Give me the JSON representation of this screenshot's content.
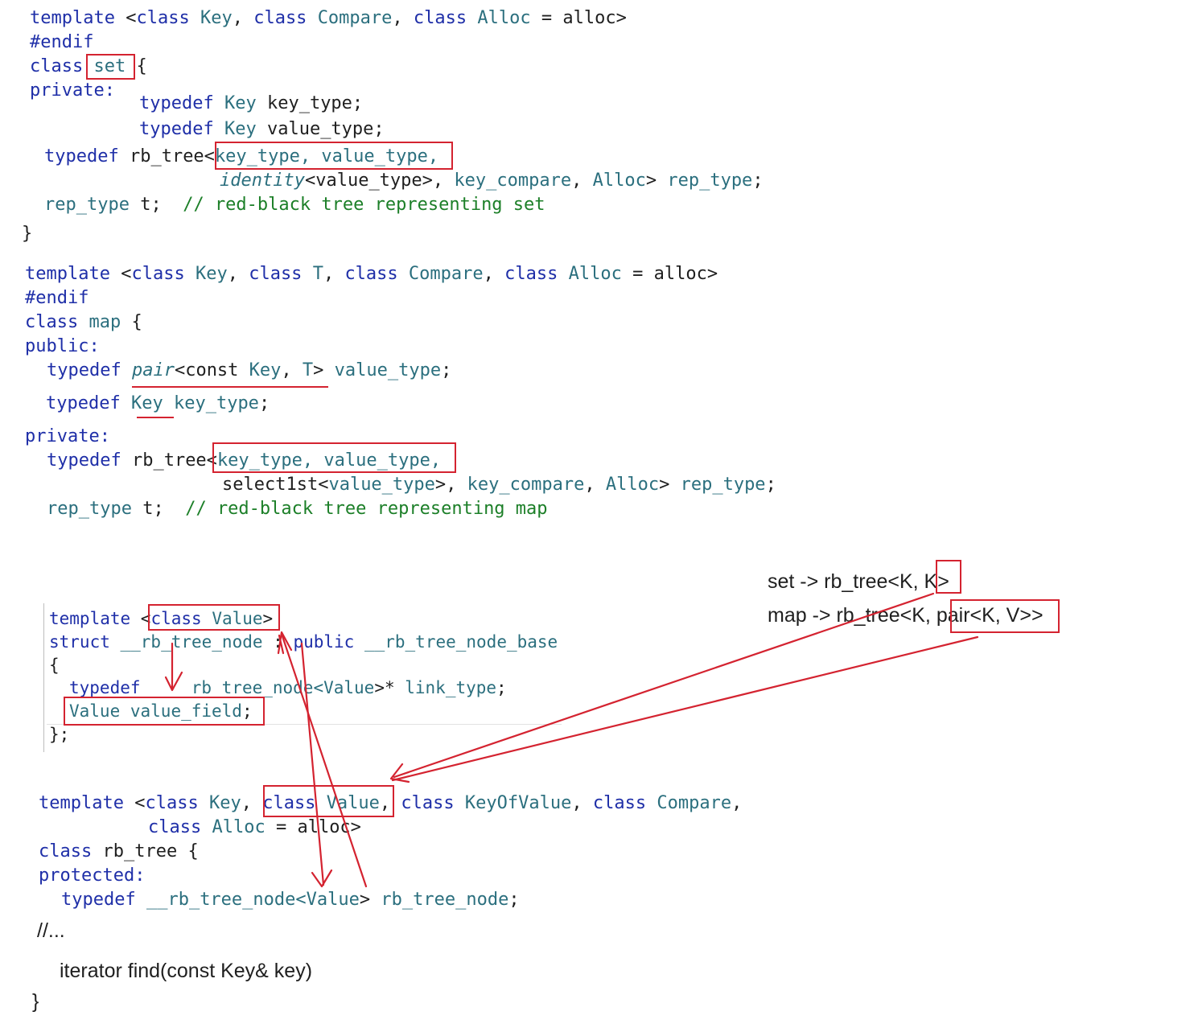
{
  "set_block": {
    "line1": [
      "template ",
      "<",
      "class",
      " ",
      "Key",
      ", ",
      "class",
      " ",
      "Compare",
      ", ",
      "class",
      " ",
      "Alloc",
      " = alloc>"
    ],
    "line2": "#endif",
    "line3_kw": "class",
    "line3_name": " set ",
    "line3_rest": "{",
    "line4": "private:",
    "line5": [
      "typedef",
      " ",
      "Key",
      " key_type;"
    ],
    "line6": [
      "typedef",
      " ",
      "Key",
      " value_type;"
    ],
    "line7": [
      "typedef",
      " rb_tree<",
      "key_type, value_type,"
    ],
    "line8": [
      "identity",
      "<value_type>, ",
      "key_compare",
      ", ",
      "Alloc",
      "> ",
      "rep_type",
      ";"
    ],
    "line9": [
      "rep_type",
      " t;  ",
      "// red-black tree representing set"
    ],
    "line10": "}"
  },
  "map_block": {
    "line1": [
      "template ",
      "<",
      "class",
      " ",
      "Key",
      ", ",
      "class",
      " ",
      "T",
      ", ",
      "class",
      " ",
      "Compare",
      ", ",
      "class",
      " ",
      "Alloc",
      " = alloc>"
    ],
    "line2": "#endif",
    "line3": [
      "class",
      " ",
      "map",
      " {"
    ],
    "line4": "public:",
    "line5": [
      "typedef",
      " ",
      "pair",
      "<const ",
      "Key",
      ", ",
      "T",
      "> ",
      "value_type",
      ";"
    ],
    "line6": [
      "typedef",
      " ",
      "Key",
      " ",
      "key_type",
      ";"
    ],
    "line7": "private:",
    "line8": [
      "typedef",
      " rb_tree<",
      "key_type, value_type,"
    ],
    "line9": [
      "select1st<",
      "value_type",
      ">, ",
      "key_compare",
      ", ",
      "Alloc",
      "> ",
      "rep_type",
      ";"
    ],
    "line10": [
      "rep_type",
      " t;  ",
      "// red-black tree representing map"
    ]
  },
  "node_block": {
    "line1": [
      "template ",
      "<",
      "class",
      " ",
      "Value",
      ">"
    ],
    "line2": [
      "struct",
      " __rb_tree_node ",
      ": ",
      "public",
      " __rb_tree_node_base"
    ],
    "line3": "{",
    "line4": [
      "typedef",
      "   __rb_tree_node<",
      "Value",
      ">* ",
      "link_type",
      ";"
    ],
    "line5": [
      "Value",
      " ",
      "value_field",
      ";"
    ],
    "line6": "};"
  },
  "tree_block": {
    "line1": [
      "template ",
      "<",
      "class",
      " ",
      "Key",
      ", ",
      "class",
      " ",
      "Value",
      ", ",
      "class",
      " ",
      "KeyOfValue",
      ", ",
      "class",
      " ",
      "Compare",
      ","
    ],
    "line2": [
      "class",
      " ",
      "Alloc",
      " = alloc>"
    ],
    "line3": [
      "class",
      " rb_tree {"
    ],
    "line4": "protected:",
    "line5": [
      "typedef",
      " __rb_tree_node<",
      "Value",
      "> ",
      "rb_tree_node",
      ";"
    ],
    "line6": "//...",
    "line7": "iterator find(const Key& key)",
    "line8": "}"
  },
  "notes": {
    "set_line": [
      "set -> rb_tree<K, ",
      "K",
      ">"
    ],
    "map_line": [
      "map -> rb_tree<K, ",
      "pair<K, V>",
      ">"
    ]
  },
  "colors": {
    "keyword": "#1f2fa8",
    "type": "#2b6f7e",
    "comment": "#1c7f28",
    "annotation": "#d42330"
  }
}
